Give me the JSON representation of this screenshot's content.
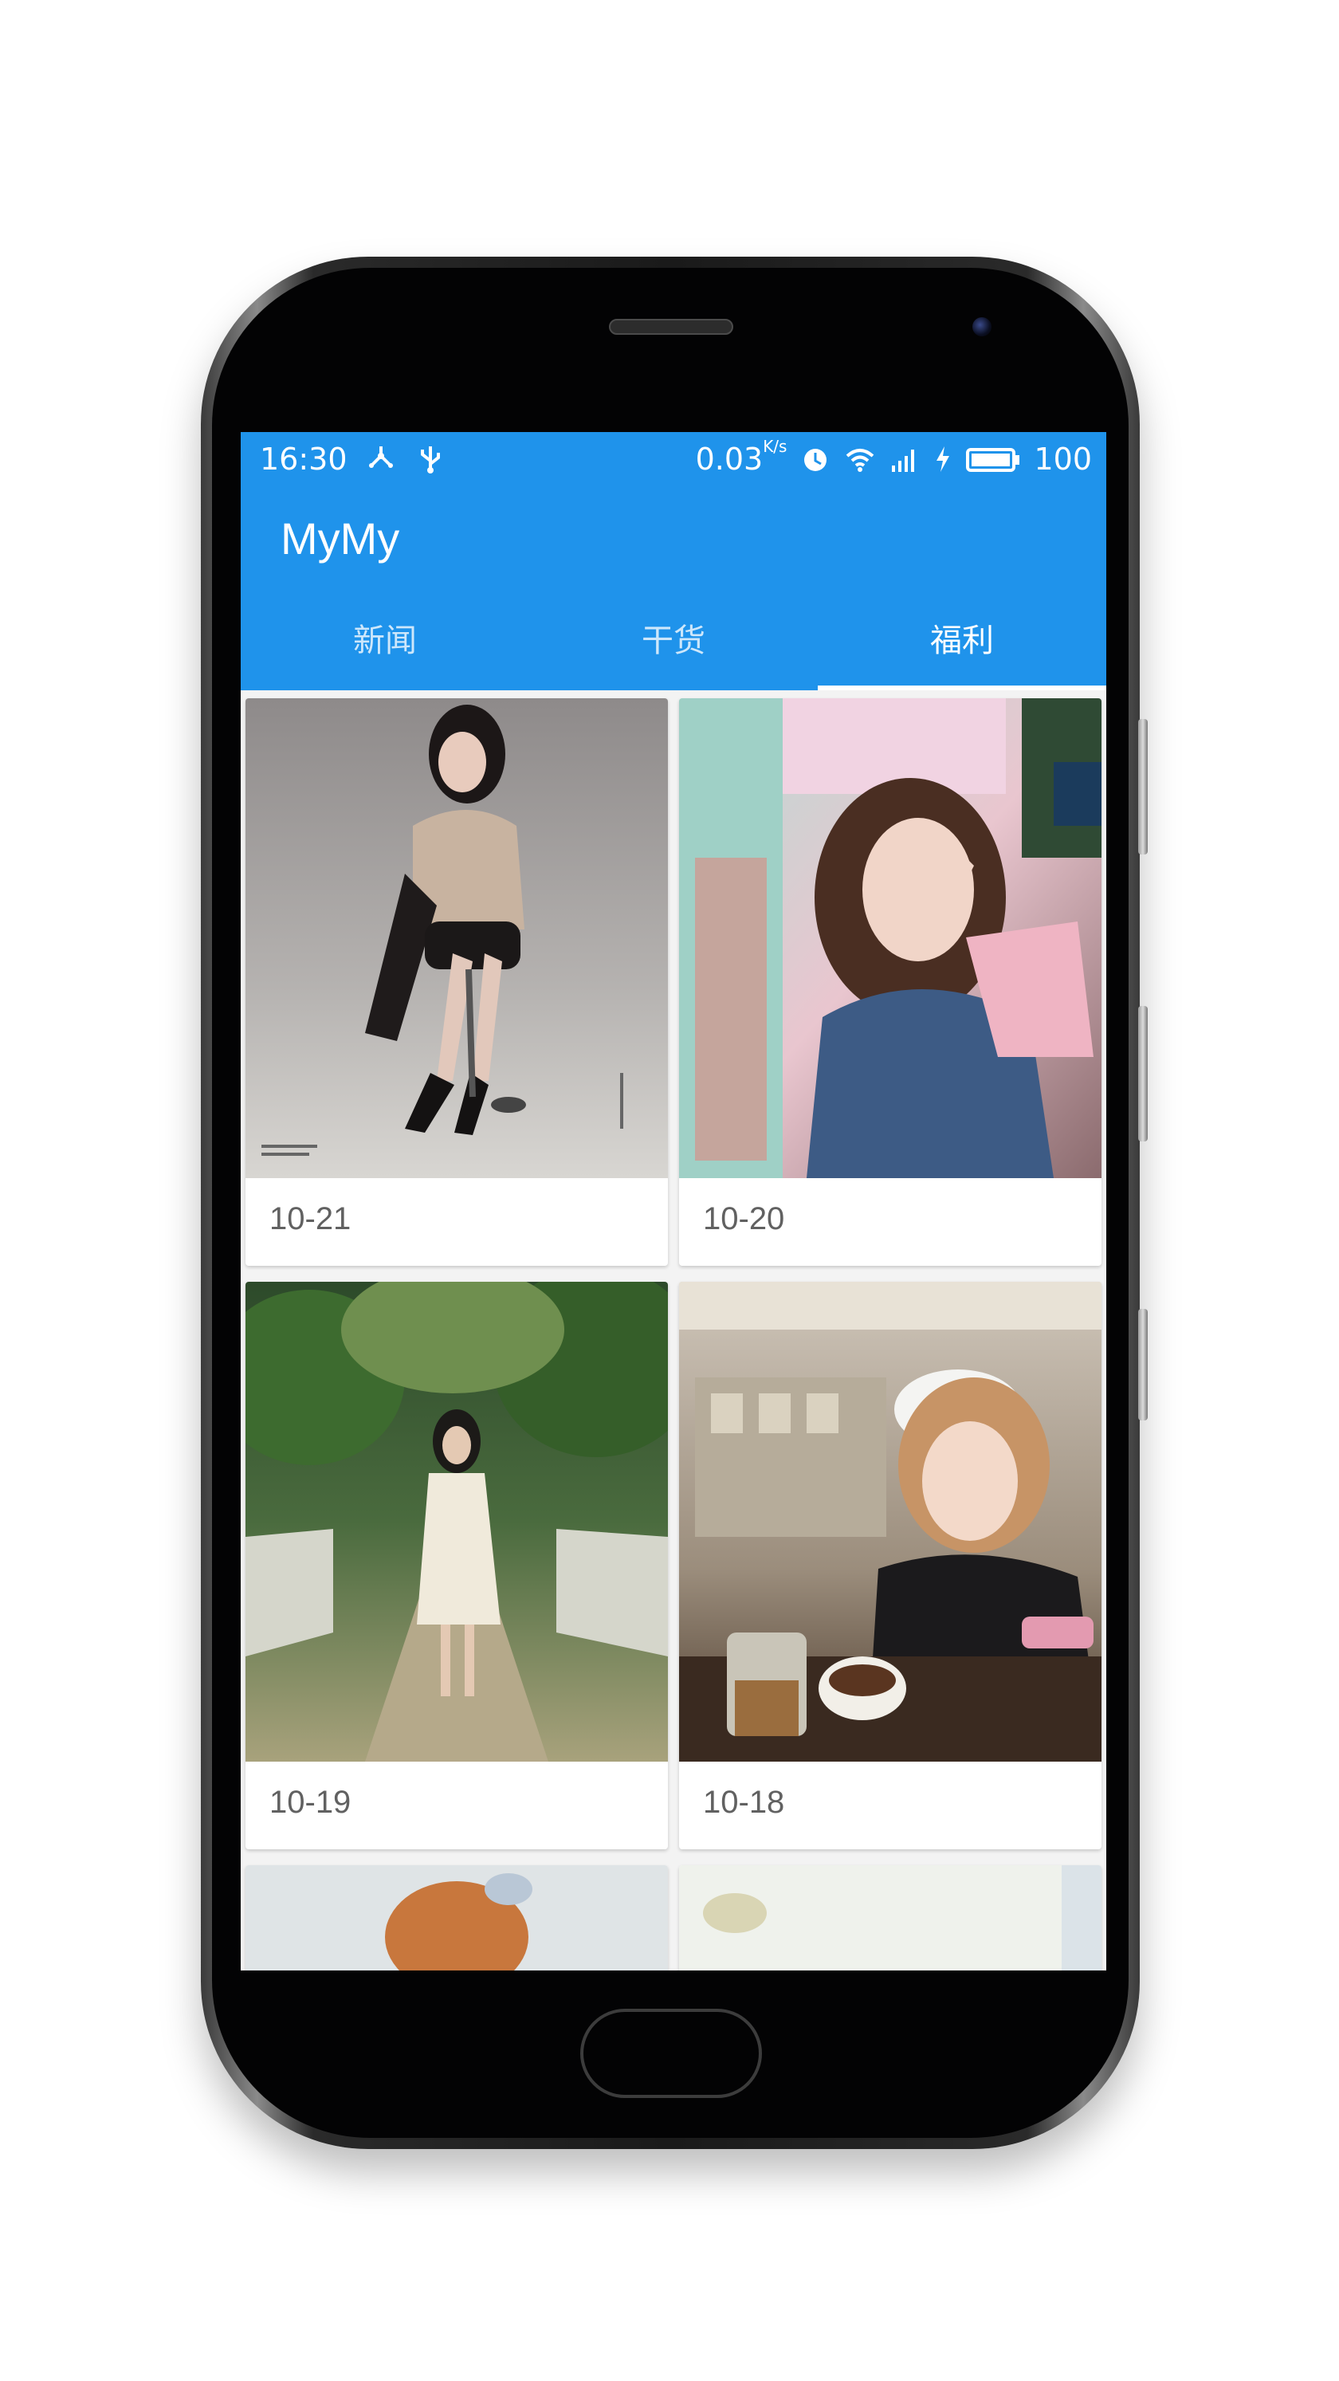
{
  "status_bar": {
    "time": "16:30",
    "net_speed": "0.03",
    "net_speed_unit": "K/s",
    "battery": "100",
    "icons": [
      "share-icon",
      "usb-icon",
      "alarm-icon",
      "wifi-icon",
      "signal-icon",
      "charging-icon",
      "battery-icon"
    ]
  },
  "app": {
    "title": "MyMy",
    "accent_color": "#1f93eb"
  },
  "tabs": [
    {
      "label": "新闻",
      "active": false
    },
    {
      "label": "干货",
      "active": false
    },
    {
      "label": "福利",
      "active": true
    }
  ],
  "cards": [
    {
      "date": "10-21",
      "image": "photo-woman-seated-on-stool"
    },
    {
      "date": "10-20",
      "image": "photo-girl-peace-sign-denim-jacket"
    },
    {
      "date": "10-19",
      "image": "photo-woman-white-dress-garden-path"
    },
    {
      "date": "10-18",
      "image": "photo-girl-white-cap-in-cafe"
    },
    {
      "date": "",
      "image": "photo-partial"
    },
    {
      "date": "",
      "image": "photo-partial"
    }
  ]
}
